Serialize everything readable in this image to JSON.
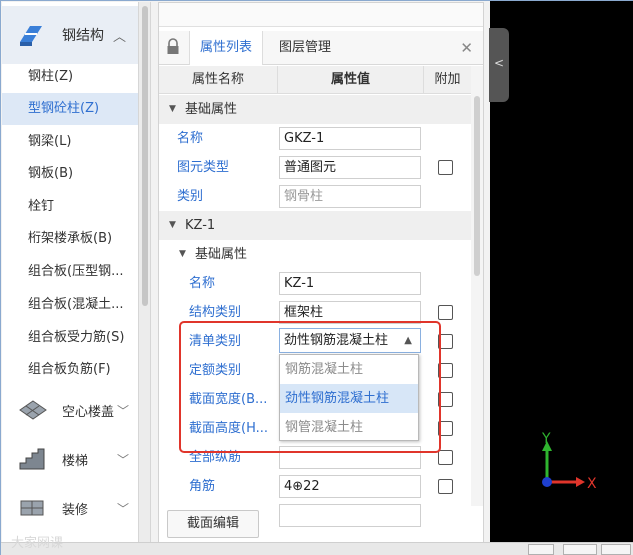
{
  "left_nav": {
    "header": {
      "label": "钢结构",
      "icon": "steel-structure-icon"
    },
    "items": [
      {
        "label": "钢柱(Z)",
        "active": false
      },
      {
        "label": "型钢砼柱(Z)",
        "active": true
      },
      {
        "label": "钢梁(L)",
        "active": false
      },
      {
        "label": "钢板(B)",
        "active": false
      },
      {
        "label": "栓钉",
        "active": false
      },
      {
        "label": "桁架楼承板(B)",
        "active": false
      },
      {
        "label": "组合板(压型钢...",
        "active": false
      },
      {
        "label": "组合板(混凝土...",
        "active": false
      },
      {
        "label": "组合板受力筋(S)",
        "active": false
      },
      {
        "label": "组合板负筋(F)",
        "active": false
      }
    ],
    "groups": [
      {
        "label": "空心楼盖",
        "icon": "hollow-floor-icon"
      },
      {
        "label": "楼梯",
        "icon": "stairs-icon"
      },
      {
        "label": "装修",
        "icon": "decoration-icon"
      }
    ]
  },
  "panel": {
    "tabs": {
      "properties": "属性列表",
      "layers": "图层管理"
    },
    "columns": {
      "name": "属性名称",
      "value": "属性值",
      "extra": "附加"
    },
    "rows": {
      "g1": "基础属性",
      "r_name": {
        "name": "名称",
        "value": "GKZ-1"
      },
      "r_type": {
        "name": "图元类型",
        "value": "普通图元"
      },
      "r_cat": {
        "name": "类别",
        "value": "钢骨柱"
      },
      "g2": "KZ-1",
      "g3": "基础属性",
      "r2_name": {
        "name": "名称",
        "value": "KZ-1"
      },
      "r2_struct": {
        "name": "结构类别",
        "value": "框架柱"
      },
      "r2_list": {
        "name": "清单类别",
        "value": "劲性钢筋混凝土柱"
      },
      "r2_quota": {
        "name": "定额类别"
      },
      "r2_width": {
        "name": "截面宽度(B..."
      },
      "r2_height": {
        "name": "截面高度(H..."
      },
      "r2_all": {
        "name": "全部纵筋"
      },
      "r2_corner": {
        "name": "角筋",
        "value": "4⊕22"
      }
    },
    "dropdown_options": [
      "钢筋混凝土柱",
      "劲性钢筋混凝土柱",
      "钢管混凝土柱"
    ],
    "dropdown_selected": 1,
    "edit_button": "截面编辑"
  },
  "viewport": {
    "axis_y": "Y",
    "axis_x": "X",
    "colors": {
      "y_axis": "#2fb52f",
      "x_axis": "#e0352b",
      "origin": "#1e3fcf"
    }
  },
  "watermark": "大家网课"
}
